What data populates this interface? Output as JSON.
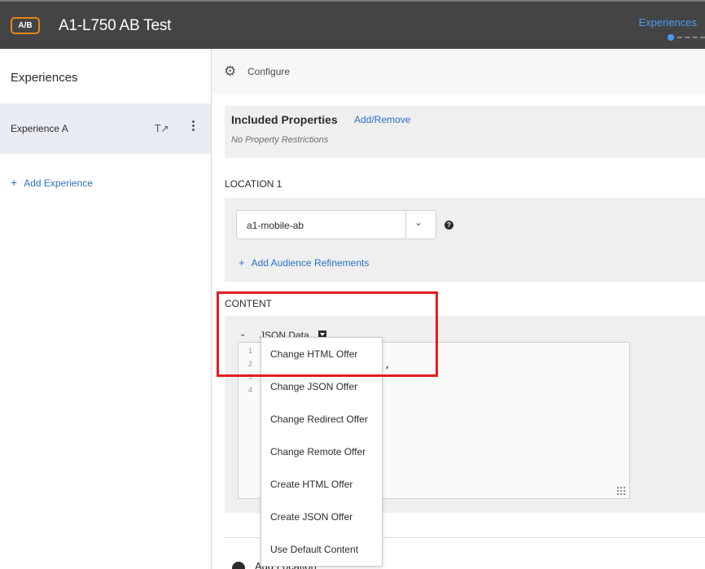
{
  "header": {
    "badge": "A/B",
    "title": "A1-L750 AB Test",
    "step_label": "Experiences"
  },
  "sidebar": {
    "title": "Experiences",
    "experience_item": "Experience A",
    "add_experience": "Add Experience"
  },
  "main": {
    "configure_label": "Configure",
    "included_properties": {
      "title": "Included Properties",
      "link": "Add/Remove",
      "note": "No Property Restrictions"
    },
    "location": {
      "label": "LOCATION 1",
      "selected_value": "a1-mobile-ab",
      "help": "?",
      "add_audience": "Add Audience Refinements"
    },
    "content": {
      "label": "CONTENT",
      "offer_label": "JSON Data",
      "line_numbers": [
        "1",
        "2",
        "3",
        "4"
      ],
      "code_fragment": ","
    },
    "bottom_partial_text": "Add Location"
  },
  "dropdown_menu": {
    "items": [
      "Change HTML Offer",
      "Change JSON Offer",
      "Change Redirect Offer",
      "Change Remote Offer",
      "Create HTML Offer",
      "Create JSON Offer",
      "Use Default Content"
    ]
  },
  "colors": {
    "header_bg": "#444444",
    "accent_blue": "#2d6fc7",
    "badge_orange": "#e68619",
    "highlight_red": "#e11d22"
  }
}
